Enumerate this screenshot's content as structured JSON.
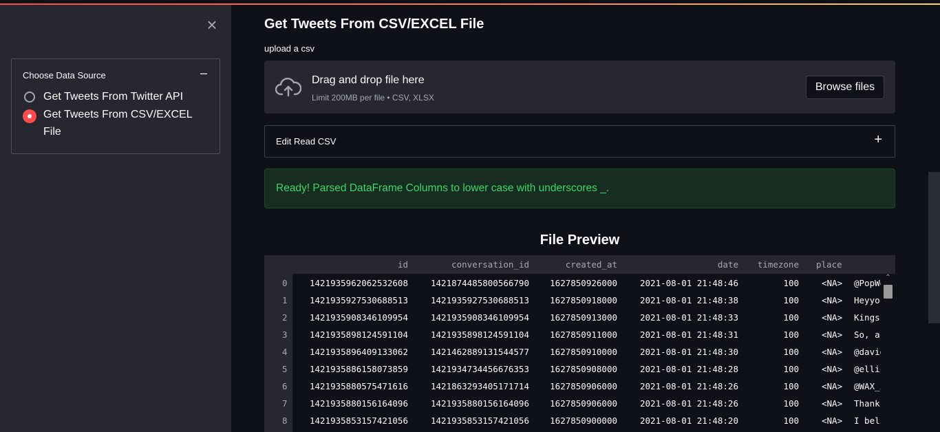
{
  "sidebar": {
    "close_symbol": "×",
    "data_source": {
      "title": "Choose Data Source",
      "collapse_symbol": "–",
      "options": [
        {
          "label": "Get Tweets From Twitter API",
          "selected": false
        },
        {
          "label": "Get Tweets From CSV/EXCEL File",
          "selected": true
        }
      ]
    }
  },
  "main": {
    "title": "Get Tweets From CSV/EXCEL File",
    "upload_label": "upload a csv",
    "dropzone": {
      "icon": "cloud-upload-icon",
      "title": "Drag and drop file here",
      "limit": "Limit 200MB per file • CSV, XLSX",
      "browse_label": "Browse files"
    },
    "expander": {
      "label": "Edit Read CSV",
      "symbol": "+"
    },
    "success_message": "Ready! Parsed DataFrame Columns to lower case with underscores _.",
    "preview_title": "File Preview",
    "table": {
      "columns": [
        "id",
        "conversation_id",
        "created_at",
        "date",
        "timezone",
        "place"
      ],
      "rows": [
        {
          "index": "0",
          "id": "1421935962062532608",
          "conversation_id": "1421874485800566790",
          "created_at": "1627850926000",
          "date": "2021-08-01 21:48:46",
          "timezone": "100",
          "place": "<NA>",
          "tweet": "@PopWo"
        },
        {
          "index": "1",
          "id": "1421935927530688513",
          "conversation_id": "1421935927530688513",
          "created_at": "1627850918000",
          "date": "2021-08-01 21:48:38",
          "timezone": "100",
          "place": "<NA>",
          "tweet": "Heyyo"
        },
        {
          "index": "2",
          "id": "1421935908346109954",
          "conversation_id": "1421935908346109954",
          "created_at": "1627850913000",
          "date": "2021-08-01 21:48:33",
          "timezone": "100",
          "place": "<NA>",
          "tweet": "Kings"
        },
        {
          "index": "3",
          "id": "1421935898124591104",
          "conversation_id": "1421935898124591104",
          "created_at": "1627850911000",
          "date": "2021-08-01 21:48:31",
          "timezone": "100",
          "place": "<NA>",
          "tweet": "So, a:"
        },
        {
          "index": "4",
          "id": "1421935896409133062",
          "conversation_id": "1421462889131544577",
          "created_at": "1627850910000",
          "date": "2021-08-01 21:48:30",
          "timezone": "100",
          "place": "<NA>",
          "tweet": "@david"
        },
        {
          "index": "5",
          "id": "1421935886158073859",
          "conversation_id": "1421934734456676353",
          "created_at": "1627850908000",
          "date": "2021-08-01 21:48:28",
          "timezone": "100",
          "place": "<NA>",
          "tweet": "@ellic"
        },
        {
          "index": "6",
          "id": "1421935880575471616",
          "conversation_id": "1421863293405171714",
          "created_at": "1627850906000",
          "date": "2021-08-01 21:48:26",
          "timezone": "100",
          "place": "<NA>",
          "tweet": "@WAX_i"
        },
        {
          "index": "7",
          "id": "1421935880156164096",
          "conversation_id": "1421935880156164096",
          "created_at": "1627850906000",
          "date": "2021-08-01 21:48:26",
          "timezone": "100",
          "place": "<NA>",
          "tweet": "Thank"
        },
        {
          "index": "8",
          "id": "1421935853157421056",
          "conversation_id": "1421935853157421056",
          "created_at": "1627850900000",
          "date": "2021-08-01 21:48:20",
          "timezone": "100",
          "place": "<NA>",
          "tweet": "I beli"
        }
      ]
    }
  },
  "colors": {
    "accent": "#ff4b4b",
    "success_text": "#3dd56d",
    "background": "#0e1117",
    "sidebar": "#262730"
  }
}
